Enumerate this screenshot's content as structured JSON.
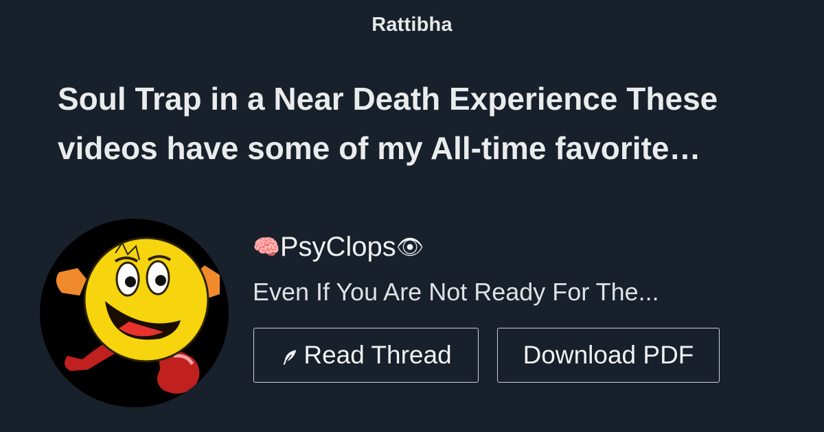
{
  "brand": {
    "name": "Rattibha"
  },
  "thread": {
    "title": "Soul Trap in a Near Death Experience These videos have some of my All-time favorite…",
    "title_line1": "Soul Trap in a Near Death Experience These",
    "title_line2": "videos have some of my All-time favorite…",
    "excerpt": "Even If You Are Not Ready For The..."
  },
  "author": {
    "prefix_emoji": "🧠",
    "name": "PsyClops",
    "suffix_emoji": "👁",
    "avatar_icon": "pacman-avatar"
  },
  "actions": {
    "read_label": "Read Thread",
    "read_icon": "feather-icon",
    "pdf_label": "Download PDF"
  },
  "colors": {
    "background": "#18202b",
    "text": "#e8eaed",
    "button_border": "#d0d3d6"
  }
}
